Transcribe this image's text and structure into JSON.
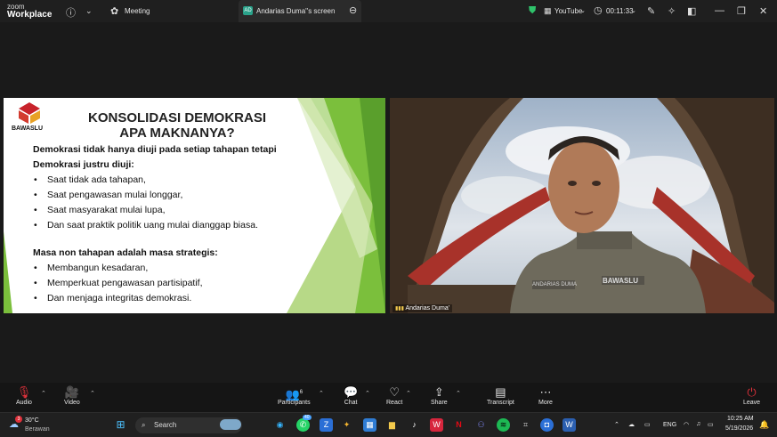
{
  "titlebar": {
    "logo_top": "zoom",
    "logo_bottom": "Workplace",
    "tab_meeting": "Meeting",
    "tab_share": "Andarias Duma''s screen",
    "tab_share_badge": "AD",
    "youtube": "YouTube",
    "timer": "00:11:33"
  },
  "slide": {
    "brand": "BAWASLU",
    "title_line1": "KONSOLIDASI DEMOKRASI",
    "title_line2": "APA MAKNANYA?",
    "intro_line1": "Demokrasi tidak hanya diuji pada setiap tahapan tetapi",
    "intro_line2": "Demokrasi justru diuji:",
    "list1": [
      "Saat tidak ada tahapan,",
      "Saat pengawasan mulai longgar,",
      "Saat masyarakat mulai lupa,",
      "Dan saat praktik politik uang mulai dianggap biasa."
    ],
    "section2": "Masa non tahapan adalah masa strategis:",
    "list2": [
      "Membangun kesadaran,",
      "Memperkuat pengawasan partisipatif,",
      "Dan menjaga integritas demokrasi."
    ]
  },
  "video": {
    "participant_name": "Andarias Duma'",
    "badge_text": "BAWASLU",
    "nametag": "ANDARIAS DUMA"
  },
  "controls": {
    "audio": "Audio",
    "video": "Video",
    "participants": "Participants",
    "participants_count": "6",
    "chat": "Chat",
    "react": "React",
    "share": "Share",
    "transcript": "Transcript",
    "more": "More",
    "leave": "Leave"
  },
  "taskbar": {
    "weather_temp": "30°C",
    "weather_desc": "Berawan",
    "weather_badge": "3",
    "search": "Search",
    "whatsapp_badge": "40",
    "lang": "ENG",
    "time": "10:25 AM",
    "date": "5/19/2026"
  },
  "colors": {
    "slide_green_dark": "#5a9f2c",
    "slide_green_light": "#b7d987",
    "bawaslu_red": "#c8232b",
    "leave_red": "#e0313b",
    "shield_green": "#2fc36b"
  }
}
